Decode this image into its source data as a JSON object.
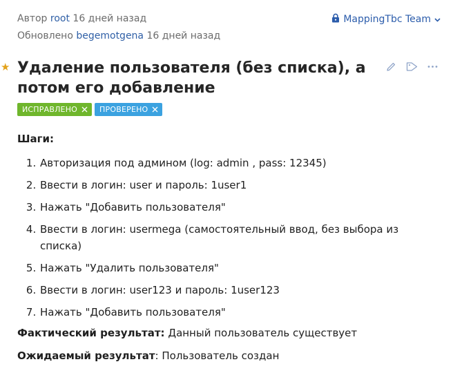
{
  "meta": {
    "author_label": "Автор",
    "author": "root",
    "author_time": "16 дней назад",
    "updated_label": "Обновлено",
    "updated_by": "begemotgena",
    "updated_time": "16 дней назад"
  },
  "team": {
    "label": "MappingTbc Team",
    "icon": "lock-icon"
  },
  "issue": {
    "title": "Удаление пользователя (без списка), а потом его добавление",
    "starred": true
  },
  "tags": [
    {
      "label": "ИСПРАВЛЕНО",
      "color": "#6fb62c"
    },
    {
      "label": "ПРОВЕРЕНО",
      "color": "#3ba2e0"
    }
  ],
  "body": {
    "steps_title": "Шаги:",
    "steps": [
      "Авторизация под админом (log: admin , pass: 12345)",
      "Ввести в логин: user и пароль: 1user1",
      "Нажать \"Добавить пользователя\"",
      "Ввести в логин: usermega (самостоятельный ввод, без выбора из списка)",
      "Нажать \"Удалить пользователя\"",
      "Ввести в логин: user123 и пароль: 1user123",
      "Нажать \"Добавить пользователя\""
    ],
    "actual_label": "Фактический результат:",
    "actual_value": "Данный пользователь существует",
    "expected_label": "Ожидаемый результат",
    "expected_value": ": Пользователь создан"
  }
}
